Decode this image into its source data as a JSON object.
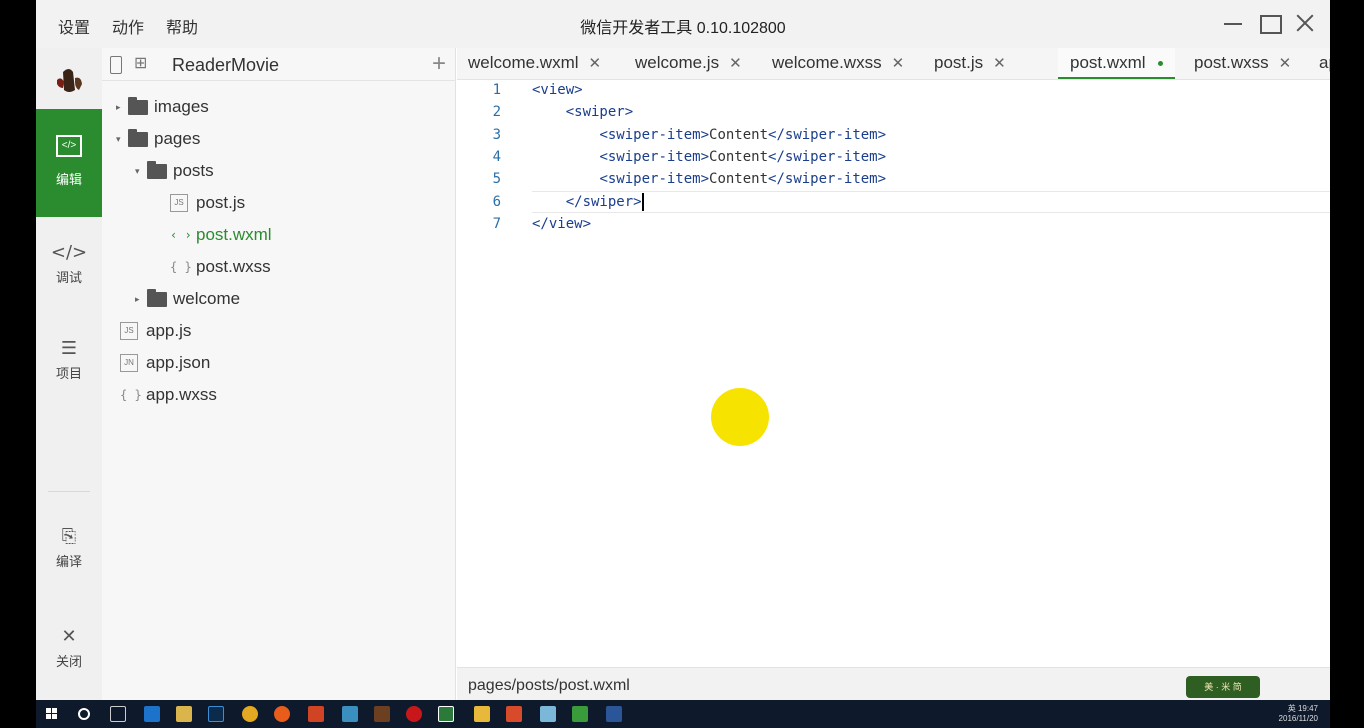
{
  "app": {
    "title": "微信开发者工具 0.10.102800",
    "menu": [
      "设置",
      "动作",
      "帮助"
    ]
  },
  "sidebar": {
    "items": [
      {
        "label": "编辑",
        "icon": "code-box-icon"
      },
      {
        "label": "调试",
        "icon": "code-icon"
      },
      {
        "label": "项目",
        "icon": "menu-icon"
      },
      {
        "label": "编译",
        "icon": "compile-icon"
      },
      {
        "label": "关闭",
        "icon": "close-icon"
      }
    ],
    "edit_glyph": "</>",
    "debug_glyph": "</>",
    "project_glyph": "☰",
    "compile_glyph": "⎘",
    "close_glyph": "✕"
  },
  "tree": {
    "project_name": "ReaderMovie",
    "add_glyph": "+",
    "nodes": {
      "images": "images",
      "pages": "pages",
      "posts": "posts",
      "post_js": "post.js",
      "post_wxml": "post.wxml",
      "post_wxss": "post.wxss",
      "welcome": "welcome",
      "app_js": "app.js",
      "app_json": "app.json",
      "app_wxss": "app.wxss"
    },
    "badges": {
      "js": "JS",
      "json": "JN",
      "xml": "‹ ›",
      "css": "{ }"
    }
  },
  "tabs": [
    {
      "label": "welcome.wxml",
      "close": "✕"
    },
    {
      "label": "welcome.js",
      "close": "✕"
    },
    {
      "label": "welcome.wxss",
      "close": "✕"
    },
    {
      "label": "post.js",
      "close": "✕"
    },
    {
      "label": "post.wxml",
      "active": true
    },
    {
      "label": "post.wxss",
      "close": "✕"
    },
    {
      "label": "app.js",
      "close": ""
    }
  ],
  "editor": {
    "line_numbers": [
      "1",
      "2",
      "3",
      "4",
      "5",
      "6",
      "7"
    ],
    "lines": [
      {
        "indent": "",
        "open": "<view>",
        "text": "",
        "close": ""
      },
      {
        "indent": "    ",
        "open": "<swiper>",
        "text": "",
        "close": ""
      },
      {
        "indent": "        ",
        "open": "<swiper-item>",
        "text": "Content",
        "close": "</swiper-item>"
      },
      {
        "indent": "        ",
        "open": "<swiper-item>",
        "text": "Content",
        "close": "</swiper-item>"
      },
      {
        "indent": "        ",
        "open": "<swiper-item>",
        "text": "Content",
        "close": "</swiper-item>"
      },
      {
        "indent": "    ",
        "open": "</swiper>",
        "text": "",
        "close": ""
      },
      {
        "indent": "",
        "open": "</view>",
        "text": "",
        "close": ""
      }
    ]
  },
  "statusbar": {
    "path": "pages/posts/post.wxml",
    "stamp": "美 · 米 简"
  },
  "taskbar": {
    "time": "19:47",
    "date": "2016/11/20",
    "ime": "英"
  },
  "colors": {
    "accent_green": "#2a8c2e",
    "tag_blue": "#1a3e8c",
    "line_number_blue": "#2b6fa8",
    "click_indicator": "#f7e300"
  }
}
